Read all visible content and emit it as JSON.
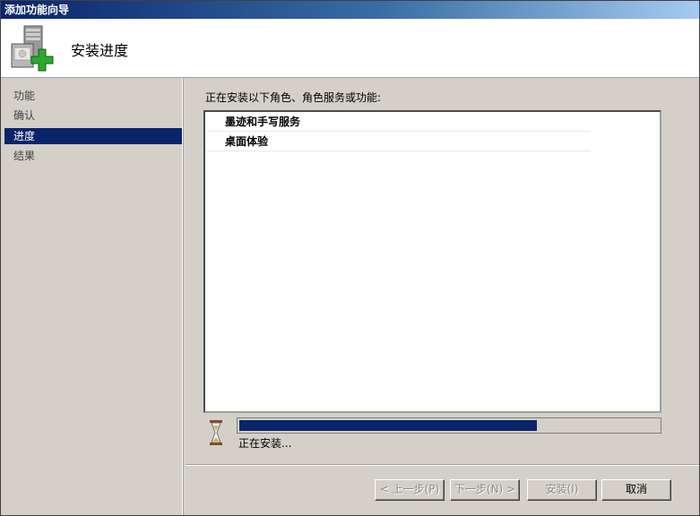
{
  "window": {
    "title": "添加功能向导"
  },
  "header": {
    "title": "安装进度",
    "icon": "server-add-icon"
  },
  "sidebar": {
    "items": [
      {
        "label": "功能",
        "active": false
      },
      {
        "label": "确认",
        "active": false
      },
      {
        "label": "进度",
        "active": true
      },
      {
        "label": "结果",
        "active": false
      }
    ]
  },
  "main": {
    "prompt": "正在安装以下角色、角色服务或功能:",
    "items": [
      {
        "label": "墨迹和手写服务"
      },
      {
        "label": "桌面体验"
      }
    ],
    "progress": {
      "fraction": 0.71
    },
    "status": "正在安装..."
  },
  "buttons": {
    "back": "< 上一步(P)",
    "next": "下一步(N) >",
    "install": "安装(I)",
    "cancel": "取消"
  },
  "colors": {
    "accent": "#0a246a",
    "face": "#d4d0c8"
  }
}
